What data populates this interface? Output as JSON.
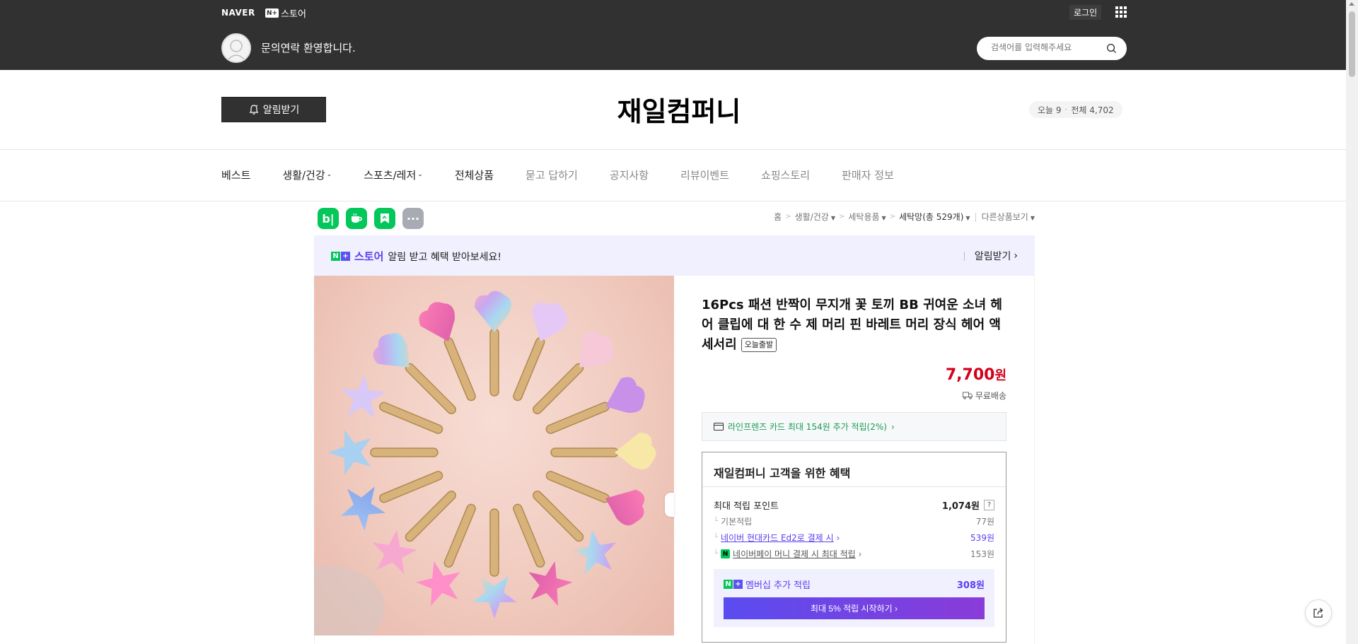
{
  "topbar": {
    "naver_logo": "NAVER",
    "nstore_badge": "N+",
    "nstore_label": "스토어",
    "login": "로그인",
    "welcome": "문의연락 환영합니다.",
    "search_placeholder": "검색어를 입력해주세요"
  },
  "header": {
    "notify_label": "알림받기",
    "store_title": "재일컴퍼니",
    "visits_today_label": "오늘 9",
    "visits_total_label": "전체 4,702"
  },
  "nav": {
    "items": [
      {
        "label": "베스트"
      },
      {
        "label": "생활/건강"
      },
      {
        "label": "스포츠/레저"
      },
      {
        "label": "전체상품"
      },
      {
        "label": "묻고 답하기"
      },
      {
        "label": "공지사항"
      },
      {
        "label": "리뷰이벤트"
      },
      {
        "label": "쇼핑스토리"
      },
      {
        "label": "판매자 정보"
      }
    ]
  },
  "share": {
    "blog": "b|",
    "more": "···"
  },
  "breadcrumb": {
    "home": "홈",
    "cat1": "생활/건강",
    "cat2": "세탁용품",
    "cat3": "세탁망",
    "cat3_count": "(총 529개)",
    "other": "다른상품보기"
  },
  "promo": {
    "badge_n": "N",
    "badge_plus": "+",
    "store": "스토어",
    "message": "알림 받고 혜택 받아보세요!",
    "action": "알림받기"
  },
  "product": {
    "title": "16Pcs 패션 반짝이 무지개 꽃 토끼 BB 귀여운 소녀 헤어 클립에 대 한 수 제 머리 핀 바레트 머리 장식 헤어 액세서리",
    "badge": "오늘출발",
    "price": "7,700",
    "price_unit": "원",
    "shipping": "무료배송",
    "card_benefit": "라인프렌즈 카드 최대 154원 추가 적립(2%)"
  },
  "benefits": {
    "title": "재일컴퍼니 고객을 위한 혜택",
    "max_points_label": "최대 적립 포인트",
    "max_points_value": "1,074원",
    "qmark": "?",
    "rows": [
      {
        "label": "기본적립",
        "value": "77원"
      },
      {
        "label": "네이버 현대카드 Ed2로 결제 시",
        "value": "539원"
      },
      {
        "label": "네이버페이 머니 결제 시 최대 적립",
        "value": "153원"
      }
    ],
    "npay_icon": "N",
    "member_label": "멤버십 추가 적립",
    "member_value": "308원",
    "member_cta": "최대 5% 적립 시작하기"
  },
  "colors": {
    "topbar_bg": "#313131",
    "naver_green": "#03c75a",
    "price_red": "#d0021b",
    "purple": "#5a3ff0"
  }
}
